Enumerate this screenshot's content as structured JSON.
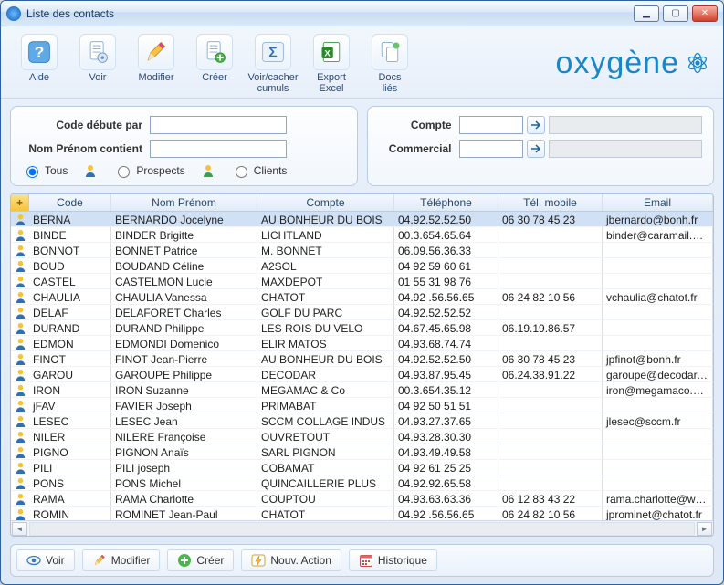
{
  "window": {
    "title": "Liste des contacts"
  },
  "brand": {
    "text": "oxygène"
  },
  "toolbar": [
    {
      "key": "aide",
      "label": "Aide",
      "icon": "help-icon"
    },
    {
      "key": "voir",
      "label": "Voir",
      "icon": "document-gear-icon"
    },
    {
      "key": "modifier",
      "label": "Modifier",
      "icon": "pencil-icon"
    },
    {
      "key": "creer",
      "label": "Créer",
      "icon": "document-plus-icon"
    },
    {
      "key": "cumuls",
      "label": "Voir/cacher cumuls",
      "icon": "sigma-icon"
    },
    {
      "key": "excel",
      "label": "Export Excel",
      "icon": "excel-icon"
    },
    {
      "key": "docs",
      "label": "Docs liés",
      "icon": "linked-docs-icon"
    }
  ],
  "filters": {
    "left": {
      "code_label": "Code débute par",
      "code_value": "",
      "nom_label": "Nom Prénom contient",
      "nom_value": "",
      "radios": {
        "tous": "Tous",
        "prospects": "Prospects",
        "clients": "Clients",
        "selected": "tous"
      }
    },
    "right": {
      "compte_label": "Compte",
      "compte_value": "",
      "commercial_label": "Commercial",
      "commercial_value": ""
    }
  },
  "grid": {
    "corner": "+",
    "headers": {
      "code": "Code",
      "nom": "Nom Prénom",
      "compte": "Compte",
      "tel": "Téléphone",
      "mob": "Tél. mobile",
      "email": "Email"
    },
    "selected_index": 0,
    "rows": [
      {
        "code": "BERNA",
        "nom": "BERNARDO Jocelyne",
        "compte": "AU BONHEUR DU BOIS",
        "tel": "04.92.52.52.50",
        "mob": "06 30 78 45 23",
        "email": "jbernardo@bonh.fr"
      },
      {
        "code": "BINDE",
        "nom": "BINDER Brigitte",
        "compte": "LICHTLAND",
        "tel": "00.3.654.65.64",
        "mob": "",
        "email": "binder@caramail.com"
      },
      {
        "code": "BONNOT",
        "nom": "BONNET Patrice",
        "compte": "M. BONNET",
        "tel": "06.09.56.36.33",
        "mob": "",
        "email": ""
      },
      {
        "code": "BOUD",
        "nom": "BOUDAND Céline",
        "compte": "A2SOL",
        "tel": "04 92 59 60 61",
        "mob": "",
        "email": ""
      },
      {
        "code": "CASTEL",
        "nom": "CASTELMON Lucie",
        "compte": "MAXDEPOT",
        "tel": "01 55 31 98 76",
        "mob": "",
        "email": ""
      },
      {
        "code": "CHAULIA",
        "nom": "CHAULIA Vanessa",
        "compte": "CHATOT",
        "tel": "04.92 .56.56.65",
        "mob": "06 24 82 10 56",
        "email": "vchaulia@chatot.fr"
      },
      {
        "code": "DELAF",
        "nom": "DELAFORET Charles",
        "compte": "GOLF DU PARC",
        "tel": "04.92.52.52.52",
        "mob": "",
        "email": ""
      },
      {
        "code": "DURAND",
        "nom": "DURAND Philippe",
        "compte": "LES ROIS DU VELO",
        "tel": "04.67.45.65.98",
        "mob": "06.19.19.86.57",
        "email": ""
      },
      {
        "code": "EDMON",
        "nom": "EDMONDI Domenico",
        "compte": "ELIR MATOS",
        "tel": "04.93.68.74.74",
        "mob": "",
        "email": ""
      },
      {
        "code": "FINOT",
        "nom": "FINOT Jean-Pierre",
        "compte": "AU BONHEUR DU BOIS",
        "tel": "04.92.52.52.50",
        "mob": "06 30 78 45 23",
        "email": "jpfinot@bonh.fr"
      },
      {
        "code": "GAROU",
        "nom": "GAROUPE Philippe",
        "compte": "DECODAR",
        "tel": "04.93.87.95.45",
        "mob": "06.24.38.91.22",
        "email": "garoupe@decodar.gra"
      },
      {
        "code": "IRON",
        "nom": "IRON Suzanne",
        "compte": "MEGAMAC & Co",
        "tel": "00.3.654.35.12",
        "mob": "",
        "email": "iron@megamaco.com"
      },
      {
        "code": "jFAV",
        "nom": "FAVIER Joseph",
        "compte": "PRIMABAT",
        "tel": "04 92 50 51 51",
        "mob": "",
        "email": ""
      },
      {
        "code": "LESEC",
        "nom": "LESEC Jean",
        "compte": "SCCM COLLAGE INDUS",
        "tel": "04.93.27.37.65",
        "mob": "",
        "email": "jlesec@sccm.fr"
      },
      {
        "code": "NILER",
        "nom": "NILERE Françoise",
        "compte": "OUVRETOUT",
        "tel": "04.93.28.30.30",
        "mob": "",
        "email": ""
      },
      {
        "code": "PIGNO",
        "nom": "PIGNON Anaïs",
        "compte": "SARL PIGNON",
        "tel": "04.93.49.49.58",
        "mob": "",
        "email": ""
      },
      {
        "code": "PILI",
        "nom": "PILI joseph",
        "compte": "COBAMAT",
        "tel": "04 92 61 25 25",
        "mob": "",
        "email": ""
      },
      {
        "code": "PONS",
        "nom": "PONS Michel",
        "compte": "QUINCAILLERIE PLUS",
        "tel": "04.92.92.65.58",
        "mob": "",
        "email": ""
      },
      {
        "code": "RAMA",
        "nom": "RAMA Charlotte",
        "compte": "COUPTOU",
        "tel": "04.93.63.63.36",
        "mob": "06 12 83 43 22",
        "email": "rama.charlotte@wana"
      },
      {
        "code": "ROMIN",
        "nom": "ROMINET Jean-Paul",
        "compte": "CHATOT",
        "tel": "04.92 .56.56.65",
        "mob": "06 24 82 10 56",
        "email": "jprominet@chatot.fr"
      }
    ]
  },
  "bottombar": [
    {
      "key": "voir",
      "label": "Voir",
      "icon": "eye-icon"
    },
    {
      "key": "modifier",
      "label": "Modifier",
      "icon": "pencil-icon"
    },
    {
      "key": "creer",
      "label": "Créer",
      "icon": "plus-icon"
    },
    {
      "key": "nouvaction",
      "label": "Nouv. Action",
      "icon": "bolt-icon"
    },
    {
      "key": "historique",
      "label": "Historique",
      "icon": "calendar-icon"
    }
  ]
}
